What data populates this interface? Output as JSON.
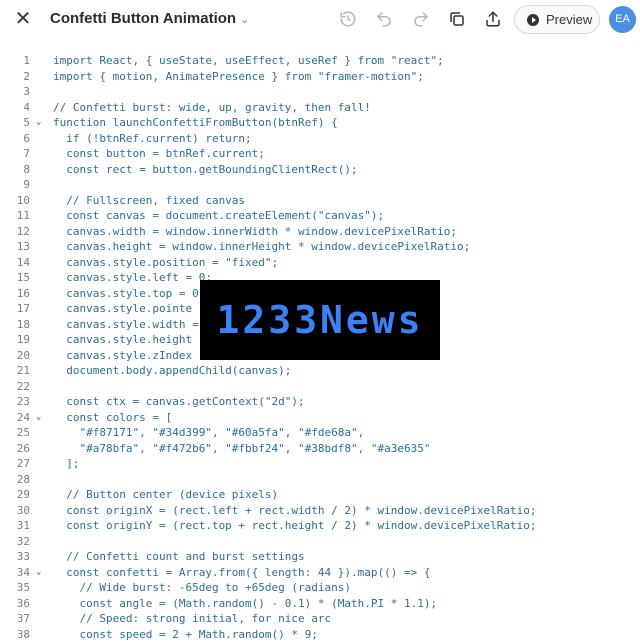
{
  "header": {
    "title": "Confetti Button Animation",
    "preview_label": "Preview",
    "avatar_initials": "EA",
    "avatar_color": "#4a90e2"
  },
  "watermark": "1233News",
  "code_lines": [
    {
      "n": "1",
      "t": "import React, { useState, useEffect, useRef } from \"react\";"
    },
    {
      "n": "2",
      "t": "import { motion, AnimatePresence } from \"framer-motion\";"
    },
    {
      "n": "3",
      "t": ""
    },
    {
      "n": "4",
      "t": "// Confetti burst: wide, up, gravity, then fall!"
    },
    {
      "n": "5",
      "t": "function launchConfettiFromButton(btnRef) {",
      "fold": true
    },
    {
      "n": "6",
      "t": "  if (!btnRef.current) return;"
    },
    {
      "n": "7",
      "t": "  const button = btnRef.current;"
    },
    {
      "n": "8",
      "t": "  const rect = button.getBoundingClientRect();"
    },
    {
      "n": "9",
      "t": ""
    },
    {
      "n": "10",
      "t": "  // Fullscreen, fixed canvas"
    },
    {
      "n": "11",
      "t": "  const canvas = document.createElement(\"canvas\");"
    },
    {
      "n": "12",
      "t": "  canvas.width = window.innerWidth * window.devicePixelRatio;"
    },
    {
      "n": "13",
      "t": "  canvas.height = window.innerHeight * window.devicePixelRatio;"
    },
    {
      "n": "14",
      "t": "  canvas.style.position = \"fixed\";"
    },
    {
      "n": "15",
      "t": "  canvas.style.left = 0;"
    },
    {
      "n": "16",
      "t": "  canvas.style.top = 0"
    },
    {
      "n": "17",
      "t": "  canvas.style.pointe"
    },
    {
      "n": "18",
      "t": "  canvas.style.width ="
    },
    {
      "n": "19",
      "t": "  canvas.style.height"
    },
    {
      "n": "20",
      "t": "  canvas.style.zIndex"
    },
    {
      "n": "21",
      "t": "  document.body.appendChild(canvas);"
    },
    {
      "n": "22",
      "t": ""
    },
    {
      "n": "23",
      "t": "  const ctx = canvas.getContext(\"2d\");"
    },
    {
      "n": "24",
      "t": "  const colors = [",
      "fold": true
    },
    {
      "n": "25",
      "t": "    \"#f87171\", \"#34d399\", \"#60a5fa\", \"#fde68a\","
    },
    {
      "n": "26",
      "t": "    \"#a78bfa\", \"#f472b6\", \"#fbbf24\", \"#38bdf8\", \"#a3e635\""
    },
    {
      "n": "27",
      "t": "  ];"
    },
    {
      "n": "28",
      "t": ""
    },
    {
      "n": "29",
      "t": "  // Button center (device pixels)"
    },
    {
      "n": "30",
      "t": "  const originX = (rect.left + rect.width / 2) * window.devicePixelRatio;"
    },
    {
      "n": "31",
      "t": "  const originY = (rect.top + rect.height / 2) * window.devicePixelRatio;"
    },
    {
      "n": "32",
      "t": ""
    },
    {
      "n": "33",
      "t": "  // Confetti count and burst settings"
    },
    {
      "n": "34",
      "t": "  const confetti = Array.from({ length: 44 }).map(() => {",
      "fold": true
    },
    {
      "n": "35",
      "t": "    // Wide burst: -65deg to +65deg (radians)"
    },
    {
      "n": "36",
      "t": "    const angle = (Math.random() - 0.1) * (Math.PI * 1.1);"
    },
    {
      "n": "37",
      "t": "    // Speed: strong initial, for nice arc"
    },
    {
      "n": "38",
      "t": "    const speed = 2 + Math.random() * 9;"
    }
  ]
}
